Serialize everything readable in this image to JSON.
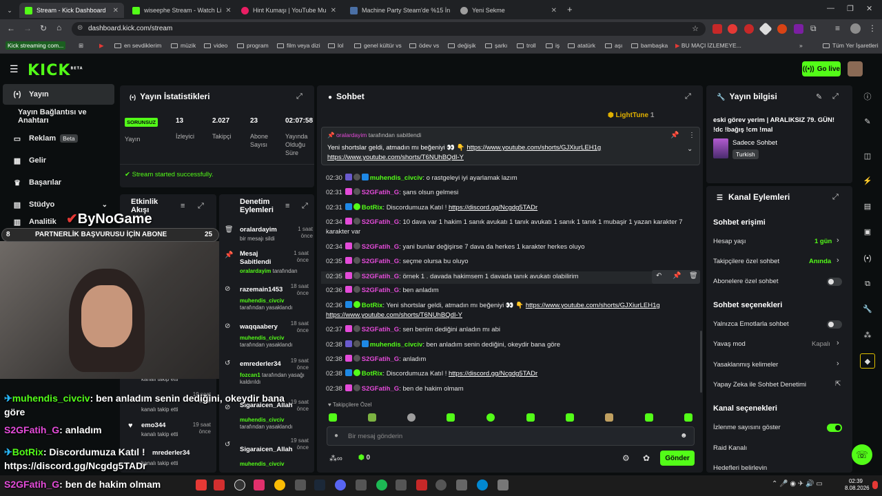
{
  "browser": {
    "tabs": [
      {
        "title": "Stream - Kick Dashboard",
        "color": "#53fc18"
      },
      {
        "title": "wiseephe Stream - Watch Li",
        "color": "#53fc18"
      },
      {
        "title": "Hint Kumaşı | YouTube Mu",
        "color": "#e91e63"
      },
      {
        "title": "Machine Party Steam'de %15 İn",
        "color": "#4a6fa5"
      },
      {
        "title": "Yeni Sekme",
        "color": "#9e9e9e"
      }
    ],
    "url": "dashboard.kick.com/stream",
    "bookmarks": [
      "Kick streaming com...",
      "en sevdiklerim",
      "müzik",
      "video",
      "program",
      "film veya dizi",
      "lol",
      "genel kültür vs",
      "ödev vs",
      "değişik",
      "şarkı",
      "troll",
      "iş",
      "atatürk",
      "aşı",
      "bambaşka",
      "BU MAÇI İZLEMEYE...",
      "Tüm Yer İşaretleri"
    ]
  },
  "app": {
    "logo": "KICK",
    "logo_beta": "BETA",
    "go_live": "Go live"
  },
  "sidebar": {
    "items": [
      {
        "label": "Yayın",
        "icon": "broadcast-icon"
      },
      {
        "label": "Yayın Bağlantısı ve Anahtarı",
        "icon": ""
      },
      {
        "label": "Reklam",
        "icon": "ad-icon",
        "badge": "Beta"
      },
      {
        "label": "Gelir",
        "icon": "wallet-icon"
      },
      {
        "label": "Başarılar",
        "icon": "trophy-icon"
      },
      {
        "label": "Stüdyo",
        "icon": "studio-icon"
      },
      {
        "label": "Analitik",
        "icon": "analytics-icon"
      }
    ]
  },
  "stats": {
    "title": "Yayın İstatistikleri",
    "status": "SORUNSUZ",
    "status_label": "Yayın",
    "cells": [
      {
        "value": "13",
        "label": "İzleyici"
      },
      {
        "value": "2.027",
        "label": "Takipçi"
      },
      {
        "value": "23",
        "label": "Abone Sayısı"
      },
      {
        "value": "02:07:58",
        "label": "Yayında Olduğu Süre"
      }
    ],
    "notice": "Stream started successfully."
  },
  "activity": {
    "title": "Etkinlik Akışı"
  },
  "moderation": {
    "title": "Denetim Eylemleri",
    "entries": [
      {
        "name": "oralardayim",
        "time": "1 saat önce",
        "sub": "bir mesajı sildi"
      },
      {
        "name": "Mesaj Sabitlendi",
        "time": "1 saat önce",
        "sub": "oralardayim tarafından"
      },
      {
        "name": "razemain1453",
        "time": "18 saat önce",
        "user": "muhendis_civciv",
        "sub": "tarafından yasaklandı"
      },
      {
        "name": "waqqaabery",
        "time": "18 saat önce",
        "user": "muhendis_civciv",
        "sub": "tarafından yasaklandı"
      },
      {
        "name": "emrederler34",
        "time": "19 saat önce",
        "user": "fozcan1",
        "sub": "tarafından yasağı kaldırıldı"
      },
      {
        "name": "Sigaraicen_Allah",
        "time": "19 saat önce",
        "user": "muhendis_civciv",
        "sub": "tarafından yasaklandı"
      },
      {
        "name": "Sigaraicen_Allah",
        "time": "19 saat önce",
        "user": "muhendis_civciv",
        "sub": ""
      }
    ],
    "events": [
      "kanalı takip etti",
      "kanalı takip etti",
      "emo344",
      "kanalı takip etti",
      "mrederler34",
      "kanalı takip etti"
    ],
    "event_times": [
      "19 saat önce",
      "19 saat önce"
    ]
  },
  "chat": {
    "title": "Sohbet",
    "top_gifter": "LightTune",
    "top_gifter_count": "1",
    "pinned": {
      "by": "oralardayim",
      "by_suffix": "tarafından sabitlendi",
      "text": "Yeni shortslar geldi, atmadın mı beğeniyi 👀 👇",
      "link1": "https://www.youtube.com/shorts/GJXiurLEH1g",
      "link2": "https://www.youtube.com/shorts/T6NUhBQdI-Y"
    },
    "messages": [
      {
        "time": "02:30",
        "user": "muhendis_civciv",
        "color": "#53fc18",
        "text": "o rastgeleyi iyi ayarlamak lazım"
      },
      {
        "time": "02:31",
        "user": "S2GFatih_G",
        "color": "#e44bd9",
        "text": "şans olsun gelmesi"
      },
      {
        "time": "02:31",
        "user": "BotRix",
        "color": "#53fc18",
        "text": "Discordumuza Katıl ! ",
        "link": "https://discord.gg/Ncgdg5TADr"
      },
      {
        "time": "02:34",
        "user": "S2GFatih_G",
        "color": "#e44bd9",
        "text": "10 dava var 1 hakim 1 sanık avukatı 1 tanık avukatı 1 sanık 1 tanık 1 mubaşir 1 yazan karakter 7 karakter var"
      },
      {
        "time": "02:34",
        "user": "S2GFatih_G",
        "color": "#e44bd9",
        "text": "yani bunlar değişirse 7 dava da herkes 1 karakter herkes oluyo"
      },
      {
        "time": "02:35",
        "user": "S2GFatih_G",
        "color": "#e44bd9",
        "text": "seçme olursa bu oluyo"
      },
      {
        "time": "02:35",
        "user": "S2GFatih_G",
        "color": "#e44bd9",
        "text": "örnek 1 . davada hakimsem 1 davada tanık avukatı olabilirim"
      },
      {
        "time": "02:36",
        "user": "S2GFatih_G",
        "color": "#e44bd9",
        "text": "ben anladım"
      },
      {
        "time": "02:36",
        "user": "BotRix",
        "color": "#53fc18",
        "text": "Yeni shortslar geldi, atmadın mı beğeniyi 👀 👇 ",
        "link": "https://www.youtube.com/shorts/GJXiurLEH1g",
        "link2": "https://www.youtube.com/shorts/T6NUhBQdI-Y"
      },
      {
        "time": "02:37",
        "user": "S2GFatih_G",
        "color": "#e44bd9",
        "text": "sen benim dediğini anladın mı abi"
      },
      {
        "time": "02:38",
        "user": "muhendis_civciv",
        "color": "#53fc18",
        "text": "ben anladım senin dediğini, okeydir bana göre"
      },
      {
        "time": "02:38",
        "user": "S2GFatih_G",
        "color": "#e44bd9",
        "text": "anladım"
      },
      {
        "time": "02:38",
        "user": "BotRix",
        "color": "#53fc18",
        "text": "Discordumuza Katıl ! ",
        "link": "https://discord.gg/Ncgdg5TADr"
      },
      {
        "time": "02:38",
        "user": "S2GFatih_G",
        "color": "#e44bd9",
        "text": "ben de hakim olmam"
      }
    ],
    "followers_only": "Takipçilere Özel",
    "input_placeholder": "Bir mesaj gönderin",
    "points": "0",
    "send": "Gönder"
  },
  "stream_info": {
    "title": "Yayın bilgisi",
    "stream_title": "eski görev yerim | ARALIKSIZ 79. GÜN! !dc !bağış !cm !mal",
    "category": "Sadece Sohbet",
    "language": "Turkish"
  },
  "channel_actions": {
    "title": "Kanal Eylemleri",
    "chat_access": "Sohbet erişimi",
    "account_age": {
      "label": "Hesap yaşı",
      "value": "1 gün"
    },
    "follower_chat": {
      "label": "Takipçilere özel sohbet",
      "value": "Anında"
    },
    "sub_chat": {
      "label": "Abonelere özel sohbet",
      "on": false
    },
    "chat_options": "Sohbet seçenekleri",
    "emote_only": {
      "label": "Yalnızca Emotlarla sohbet",
      "on": false
    },
    "slow_mode": {
      "label": "Yavaş mod",
      "value": "Kapalı"
    },
    "banned_words": "Yasaklanmış kelimeler",
    "ai_mod": "Yapay Zeka ile Sohbet Denetimi",
    "channel_options": "Kanal seçenekleri",
    "show_viewers": {
      "label": "İzlenme sayısını göster",
      "on": true
    },
    "raid": "Raid Kanalı",
    "goals": "Hedefleri belirleyin"
  },
  "overlay": {
    "brand": "ByNoGame",
    "partner_left": "8",
    "partner_text": "PARTNERLİK BAŞVURUSU İÇİN ABONE",
    "partner_right": "25",
    "lines": [
      {
        "user": "muhendis_civciv",
        "text": " ben anladım senin dediğini, okeydir bana göre",
        "color": "#53fc18"
      },
      {
        "user": "S2GFatih_G",
        "text": " anladım",
        "color": "#e44bd9"
      },
      {
        "user": "BotRix",
        "text": " Discordumuza Katıl ! https://discord.gg/Ncgdg5TADr",
        "color": "#53fc18"
      },
      {
        "user": "S2GFatih_G",
        "text": " ben de hakim olmam",
        "color": "#e44bd9"
      }
    ]
  },
  "taskbar": {
    "time": "02:39",
    "date": "8.08.2026"
  }
}
